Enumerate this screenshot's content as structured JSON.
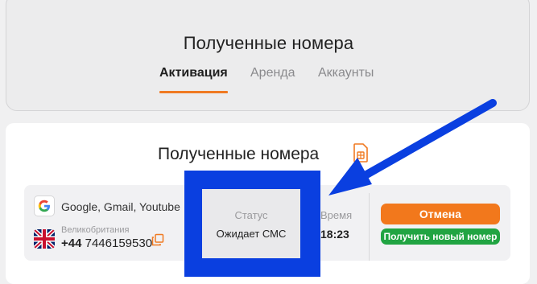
{
  "header": {
    "title": "Полученные номера",
    "tabs": [
      {
        "label": "Активация",
        "active": true
      },
      {
        "label": "Аренда",
        "active": false
      },
      {
        "label": "Аккаунты",
        "active": false
      }
    ]
  },
  "main": {
    "title": "Полученные номера",
    "title_icon": "sim-card-icon",
    "rows": [
      {
        "service_icon": "google-icon",
        "service": "Google, Gmail, Youtube",
        "country_icon": "uk-flag-icon",
        "country": "Великобритания",
        "phone_prefix": "+44",
        "phone_number": "7446159530",
        "status_label": "Статус",
        "status_value": "Ожидает СМС",
        "time_label": "Время",
        "time_value": "18:23",
        "cancel_label": "Отмена",
        "new_number_label": "Получить новый номер"
      }
    ]
  },
  "colors": {
    "accent": "#f07a22",
    "cancel_button": "#f2781c",
    "new_number_button": "#21a442",
    "highlight": "#0a3fe0"
  }
}
